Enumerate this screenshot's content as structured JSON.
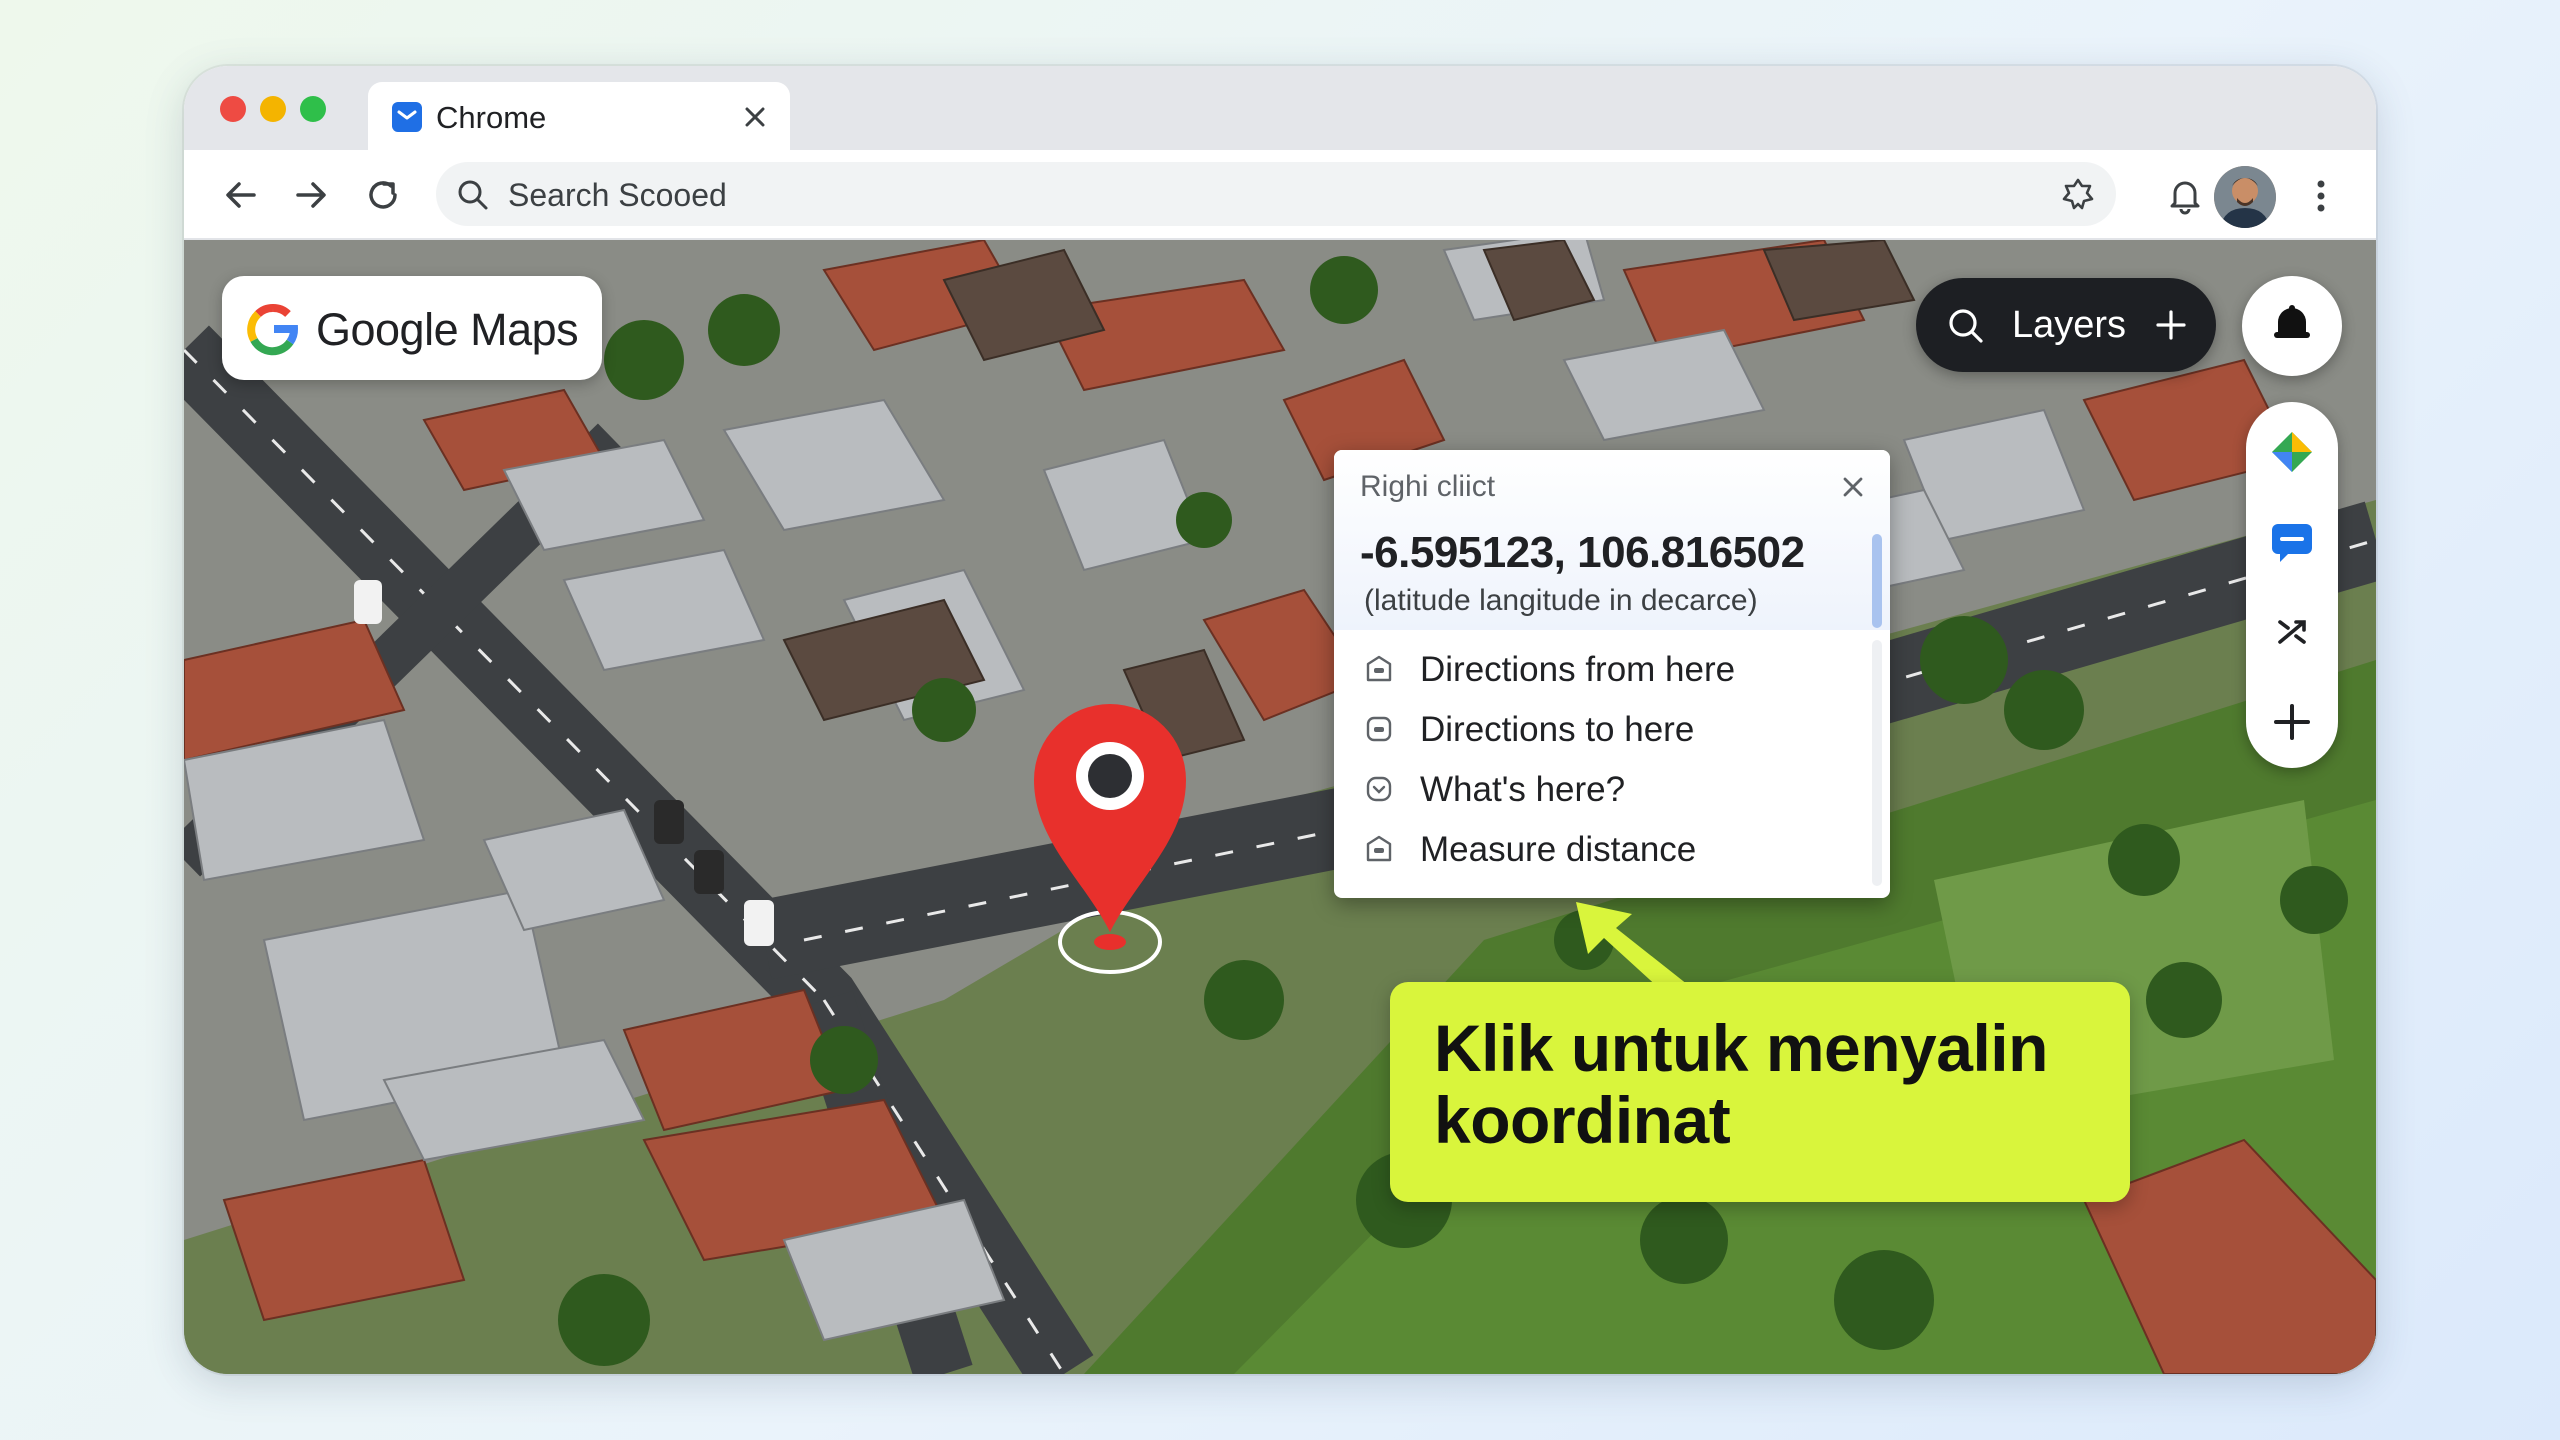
{
  "window": {
    "tab_title": "Chrome",
    "search_text": "Search Scooed"
  },
  "map": {
    "brand": "Google Maps",
    "layers_label": "Layers"
  },
  "context_menu": {
    "title": "Righi cliict",
    "coordinates": "-6.595123, 106.816502",
    "hint": "(latitude langitude in decarce)",
    "items": [
      {
        "label": "Directions from here",
        "icon": "directions-from-icon"
      },
      {
        "label": "Directions to here",
        "icon": "directions-to-icon"
      },
      {
        "label": "What's here?",
        "icon": "whats-here-icon"
      },
      {
        "label": "Measure distance",
        "icon": "measure-distance-icon"
      }
    ]
  },
  "callout": {
    "text": "Klik untuk menyalin koordinat",
    "color": "#d9f53c"
  },
  "colors": {
    "pin": "#e8302c",
    "tab_favicon": "#1f6fe5",
    "layers_bg": "#1d1f23"
  }
}
